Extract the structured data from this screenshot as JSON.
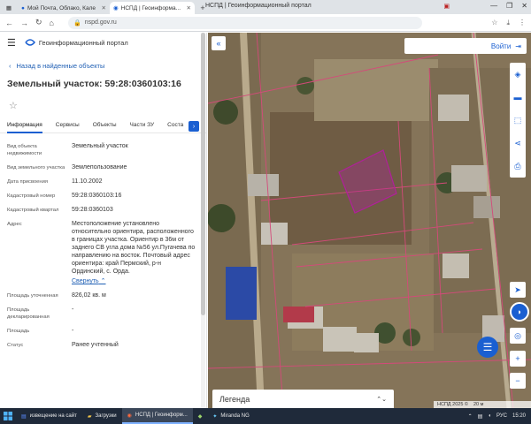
{
  "browser": {
    "window_title": "НСПД | Геоинформационный портал",
    "tabs": [
      {
        "label": "",
        "icon": "tabs-menu-icon"
      },
      {
        "label": "Мой Почта, Облако, Кале",
        "icon": "mail-icon"
      },
      {
        "label": "НСПД | Геоинформа...",
        "icon": "nspd-icon",
        "active": true
      }
    ],
    "url": "nspd.gov.ru",
    "window_controls": [
      "—",
      "❐",
      "✕"
    ]
  },
  "panel": {
    "app_name": "Геоинформационный портал",
    "back_label": "Назад в найденные объекты",
    "object_title": "Земельный участок: 59:28:0360103:16",
    "tabs": [
      "Информация",
      "Сервисы",
      "Объекты",
      "Части ЗУ",
      "Соста"
    ],
    "active_tab": 0,
    "fields": [
      {
        "key": "Вид объекта недвижимости",
        "value": "Земельный участок"
      },
      {
        "key": "Вид земельного участка",
        "value": "Землепользование"
      },
      {
        "key": "Дата присвоения",
        "value": "11.10.2002"
      },
      {
        "key": "Кадастровый номер",
        "value": "59:28:0360103:16"
      },
      {
        "key": "Кадастровый квартал",
        "value": "59:28:0360103"
      },
      {
        "key": "Адрес",
        "value": "Местоположение установлено относительно ориентира, расположенного в границах участка. Ориентир в 36м от заднего СВ угла дома №56 ул.Пугачева по направлению на восток. Почтовый адрес ориентира: край Пермский, р-н Ординский, с. Орда.",
        "more_label": "Свернуть"
      },
      {
        "key": "Площадь уточненная",
        "value": "826,02 кв. м"
      },
      {
        "key": "Площадь декларированная",
        "value": "-"
      },
      {
        "key": "Площадь",
        "value": "-"
      },
      {
        "key": "Статус",
        "value": "Ранее учтенный"
      }
    ]
  },
  "map": {
    "login_label": "Войти",
    "legend_label": "Легенда",
    "attribution": "НСПД 2025 ©",
    "scale_label": "20 м"
  },
  "taskbar": {
    "items": [
      {
        "label": "извещение на сайт",
        "icon": "word-icon"
      },
      {
        "label": "Загрузки",
        "icon": "folder-icon"
      },
      {
        "label": "НСПД | Геоинформ...",
        "icon": "browser-icon",
        "active": true
      },
      {
        "label": "",
        "icon": "app-icon"
      },
      {
        "label": "Miranda NG",
        "icon": "miranda-icon"
      }
    ],
    "lang": "РУС",
    "time": "15:20"
  },
  "colors": {
    "accent": "#1a5fd1",
    "parcel_highlight": "#b0209a"
  }
}
